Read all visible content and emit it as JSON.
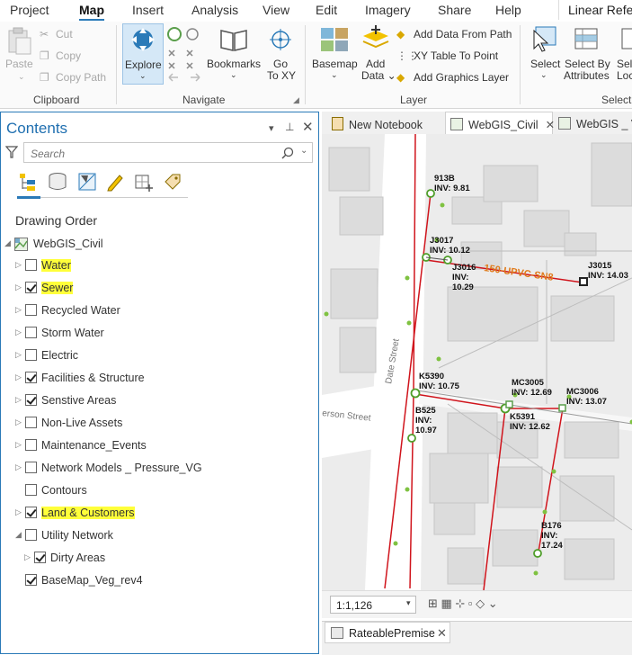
{
  "menu": {
    "items": [
      "Project",
      "Map",
      "Insert",
      "Analysis",
      "View",
      "Edit",
      "Imagery",
      "Share",
      "Help"
    ],
    "active": "Map",
    "right_tab": "Linear Refer"
  },
  "ribbon": {
    "clipboard": {
      "paste": "Paste",
      "cut": "Cut",
      "copy": "Copy",
      "copy_path": "Copy Path",
      "label": "Clipboard"
    },
    "navigate": {
      "explore": "Explore",
      "bookmarks": "Bookmarks",
      "go_to_xy": "Go\nTo XY",
      "label": "Navigate"
    },
    "layer": {
      "basemap": "Basemap",
      "add_data": "Add\nData",
      "add_data_from_path": "Add Data From Path",
      "xy_table_to_point": "XY Table To Point",
      "add_graphics_layer": "Add Graphics Layer",
      "label": "Layer"
    },
    "selection": {
      "select": "Select",
      "select_by_attributes": "Select By\nAttributes",
      "select_by_location": "Sele\nLoc",
      "label": "Selecti"
    }
  },
  "contents": {
    "title": "Contents",
    "search_placeholder": "Search",
    "heading": "Drawing Order",
    "map_name": "WebGIS_Civil",
    "layers": [
      {
        "label": "Water",
        "checked": false,
        "highlight": true,
        "expander": "right",
        "indent": 1
      },
      {
        "label": "Sewer",
        "checked": true,
        "highlight": true,
        "expander": "right",
        "indent": 1
      },
      {
        "label": "Recycled Water",
        "checked": false,
        "highlight": false,
        "expander": "right",
        "indent": 1
      },
      {
        "label": "Storm Water",
        "checked": false,
        "highlight": false,
        "expander": "right",
        "indent": 1
      },
      {
        "label": "Electric",
        "checked": false,
        "highlight": false,
        "expander": "right",
        "indent": 1
      },
      {
        "label": "Facilities & Structure",
        "checked": true,
        "highlight": false,
        "expander": "right",
        "indent": 1
      },
      {
        "label": "Senstive Areas",
        "checked": true,
        "highlight": false,
        "expander": "right",
        "indent": 1
      },
      {
        "label": "Non-Live Assets",
        "checked": false,
        "highlight": false,
        "expander": "right",
        "indent": 1
      },
      {
        "label": "Maintenance_Events",
        "checked": false,
        "highlight": false,
        "expander": "right",
        "indent": 1
      },
      {
        "label": "Network Models _ Pressure_VG",
        "checked": false,
        "highlight": false,
        "expander": "right",
        "indent": 1
      },
      {
        "label": "Contours",
        "checked": false,
        "highlight": false,
        "expander": "none",
        "indent": 1
      },
      {
        "label": "Land & Customers",
        "checked": true,
        "highlight": true,
        "expander": "right",
        "indent": 1
      },
      {
        "label": "Utility Network",
        "checked": false,
        "highlight": false,
        "expander": "down",
        "indent": 1
      },
      {
        "label": "Dirty Areas",
        "checked": true,
        "highlight": false,
        "expander": "right",
        "indent": 2
      },
      {
        "label": "BaseMap_Veg_rev4",
        "checked": true,
        "highlight": false,
        "expander": "none",
        "indent": 1
      }
    ]
  },
  "map_tabs": [
    "New Notebook",
    "WebGIS_Civil",
    "WebGIS _ Ve"
  ],
  "map_tab_active": "WebGIS_Civil",
  "map": {
    "street_date": "Date Street",
    "street_erson": "erson Street",
    "main_label": "150-UPVC-SN8",
    "labels": [
      {
        "id": "913B",
        "inv": "INV: 9.81"
      },
      {
        "id": "J3017",
        "inv": "INV: 10.12"
      },
      {
        "id": "J3016",
        "inv": "INV:",
        "inv2": "10.29"
      },
      {
        "id": "J3015",
        "inv": "INV: 14.03"
      },
      {
        "id": "K5390",
        "inv": "INV: 10.75"
      },
      {
        "id": "MC3005",
        "inv": "INV: 12.69"
      },
      {
        "id": "MC3006",
        "inv": "INV: 13.07"
      },
      {
        "id": "B525",
        "inv": "INV:",
        "inv2": "10.97"
      },
      {
        "id": "K5391",
        "inv": "INV: 12.62"
      },
      {
        "id": "B176",
        "inv": "INV:",
        "inv2": "17.24"
      }
    ],
    "scale": "1:1,126"
  },
  "bottom_tab": "RateablePremise",
  "colors": {
    "accent": "#2a7ab8",
    "highlight": "#ffff3a",
    "pipe": "#d0141c",
    "node": "#7fc241",
    "main_label": "#e07a1a"
  }
}
